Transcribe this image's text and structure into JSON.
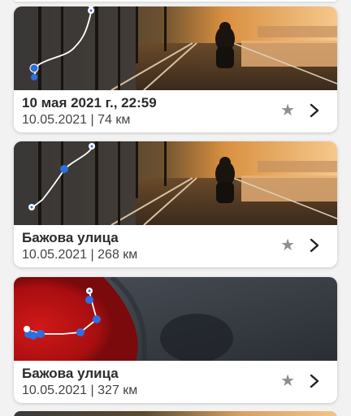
{
  "trips": [
    {
      "title": "10 мая 2021 г., 22:59",
      "date": "10.05.2021",
      "separator": "|",
      "distance": "74 км",
      "thumbnail": "sunset-motorcycle-photo",
      "favorite_icon": "star-icon",
      "open_icon": "chevron-right-icon"
    },
    {
      "title": "Бажова улица",
      "date": "10.05.2021",
      "separator": "|",
      "distance": "268 км",
      "thumbnail": "sunset-motorcycle-photo",
      "favorite_icon": "star-icon",
      "open_icon": "chevron-right-icon"
    },
    {
      "title": "Бажова улица",
      "date": "10.05.2021",
      "separator": "|",
      "distance": "327 км",
      "thumbnail": "red-abstract-photo",
      "favorite_icon": "star-icon",
      "open_icon": "chevron-right-icon"
    }
  ],
  "colors": {
    "route_line": "#ffffff",
    "route_point": "#2e6fe0",
    "star": "#8e8e8e",
    "title_text": "#2b2b2b"
  }
}
